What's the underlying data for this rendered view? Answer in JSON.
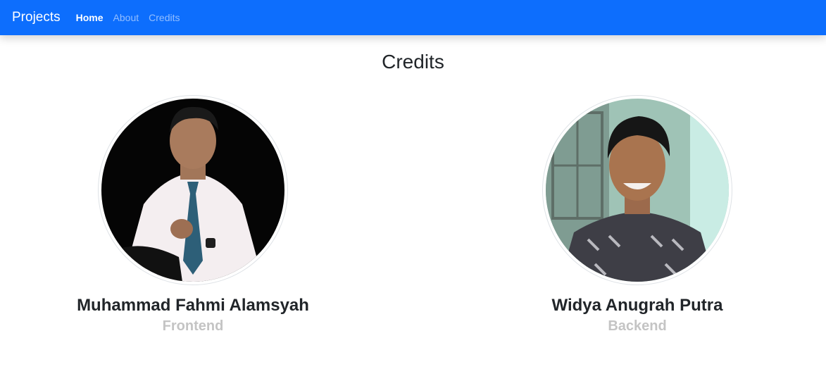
{
  "navbar": {
    "brand": "Projects",
    "links": [
      {
        "label": "Home",
        "active": true
      },
      {
        "label": "About",
        "active": false
      },
      {
        "label": "Credits",
        "active": false
      }
    ],
    "color": "#0d6efd"
  },
  "page": {
    "title": "Credits"
  },
  "credits": [
    {
      "name": "Muhammad Fahmi Alamsyah",
      "role": "Frontend"
    },
    {
      "name": "Widya Anugrah Putra",
      "role": "Backend"
    }
  ]
}
